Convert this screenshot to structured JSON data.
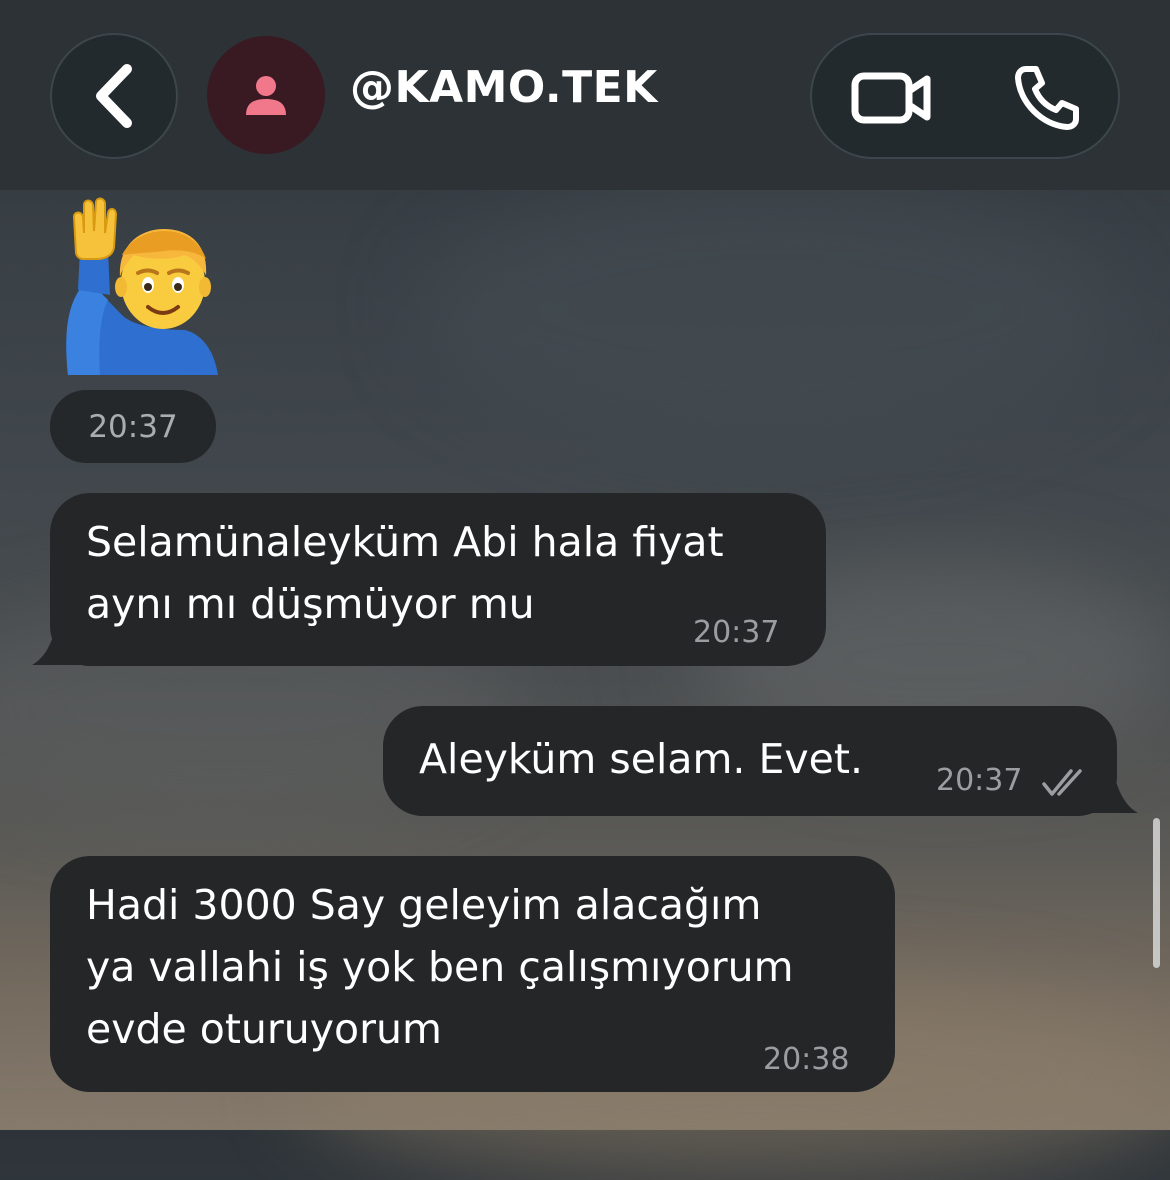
{
  "header": {
    "contact_name": "@KAMO.TEK",
    "back_icon": "chevron-left-icon",
    "avatar_icon": "person-icon",
    "video_icon": "video-camera-icon",
    "phone_icon": "phone-icon"
  },
  "messages": [
    {
      "type": "emoji",
      "direction": "incoming",
      "emoji": "🙋‍♂️",
      "emoji_name": "man-raising-hand",
      "time": "20:37"
    },
    {
      "type": "text",
      "direction": "incoming",
      "lines": [
        "Selamünaleyküm Abi hala fiyat",
        "aynı mı düşmüyor mu"
      ],
      "time": "20:37"
    },
    {
      "type": "text",
      "direction": "outgoing",
      "lines": [
        "Aleyküm selam. Evet."
      ],
      "time": "20:37",
      "status_icon": "double-check-icon"
    },
    {
      "type": "text",
      "direction": "incoming",
      "lines": [
        "Hadi 3000 Say geleyim alacağım",
        "ya vallahi iş yok ben çalışmıyorum",
        "evde oturuyorum"
      ],
      "time": "20:38"
    }
  ],
  "colors": {
    "header_bg": "#2c3236",
    "bubble_bg": "#252628",
    "avatar_bg": "#3a1a22",
    "avatar_icon": "#f0788a",
    "time_text": "#9a9ea1"
  }
}
